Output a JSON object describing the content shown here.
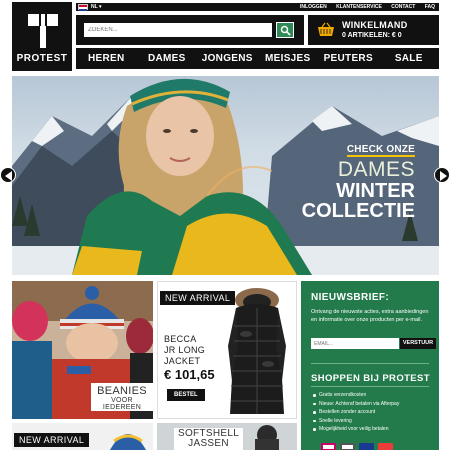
{
  "brand": {
    "name": "PROTEST"
  },
  "topbar": {
    "language": "NL",
    "links": [
      "INLOGGEN",
      "KLANTENSERVICE",
      "CONTACT",
      "FAQ"
    ]
  },
  "search": {
    "placeholder": "ZOEKEN..."
  },
  "cart": {
    "title": "WINKELMAND",
    "summary": "0 ARTIKELEN: € 0"
  },
  "nav": {
    "items": [
      "HEREN",
      "DAMES",
      "JONGENS",
      "MEISJES",
      "PEUTERS",
      "SALE"
    ]
  },
  "hero": {
    "line1": "CHECK ONZE",
    "line2": "DAMES",
    "line3": "WINTER",
    "line4": "COLLECTIE"
  },
  "tiles": {
    "beanies": {
      "line1": "BEANIES",
      "line2": "VOOR IEDEREEN"
    },
    "becca": {
      "badge": "NEW ARRIVAL",
      "name_l1": "BECCA",
      "name_l2": "JR LONG",
      "name_l3": "JACKET",
      "price": "€ 101,65",
      "button": "BESTEL"
    },
    "bottom1": {
      "badge": "NEW ARRIVAL"
    },
    "bottom2": {
      "line1": "SOFTSHELL",
      "line2": "JASSEN"
    }
  },
  "newsletter": {
    "title": "NIEUWSBRIEF:",
    "description": "Ontvang de nieuwste acties, extra aanbiedingen en informatie over onze producten per e-mail.",
    "email_placeholder": "EMAIL...",
    "button": "VERSTUUR"
  },
  "shop": {
    "title": "SHOPPEN BIJ PROTEST",
    "benefits": [
      "Gratis verzendkosten",
      "Nieuw: Achteraf betalen via Afterpay",
      "Bestellen zonder account",
      "Snelle levering",
      "Mogelijkheid voor veilig betalen"
    ]
  },
  "colors": {
    "black": "#111111",
    "green": "#237a4a",
    "search_green": "#2e8b57",
    "accent_yellow": "#f5c400"
  },
  "icons": [
    "flag-nl-icon",
    "chevron-down-icon",
    "search-icon",
    "basket-icon",
    "arrow-left-icon",
    "arrow-right-icon"
  ]
}
